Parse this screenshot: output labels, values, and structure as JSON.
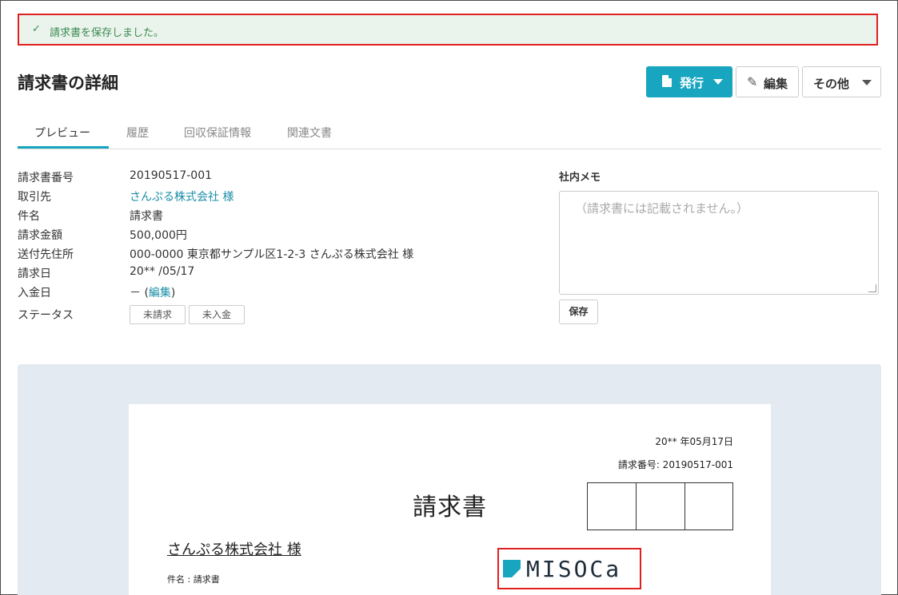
{
  "alert": {
    "message": "請求書を保存しました。",
    "status_color": "#3c8a52"
  },
  "header": {
    "title": "請求書の詳細",
    "issue_label": "発行",
    "edit_label": "編集",
    "more_label": "その他",
    "accent": "#18a5c0"
  },
  "tabs": [
    {
      "label": "プレビュー",
      "active": true
    },
    {
      "label": "履歴",
      "active": false
    },
    {
      "label": "回収保証情報",
      "active": false
    },
    {
      "label": "関連文書",
      "active": false
    }
  ],
  "details": {
    "invoice_no": {
      "label": "請求書番号",
      "value": "20190517-001"
    },
    "client": {
      "label": "取引先",
      "value": "さんぷる株式会社 様"
    },
    "subject": {
      "label": "件名",
      "value": "請求書"
    },
    "amount": {
      "label": "請求金額",
      "value": "500,000円"
    },
    "address": {
      "label": "送付先住所",
      "value": "000-0000 東京都サンプル区1-2-3 さんぷる株式会社 様"
    },
    "invoice_date": {
      "label": "請求日",
      "value": "20** /05/17"
    },
    "payment_date": {
      "label": "入金日",
      "value_prefix": "－ (",
      "edit_link": "編集",
      "value_suffix": ")"
    },
    "status": {
      "label": "ステータス",
      "tags": [
        "未請求",
        "未入金"
      ]
    }
  },
  "memo": {
    "label": "社内メモ",
    "placeholder": "（請求書には記載されません。）",
    "save_label": "保存"
  },
  "preview": {
    "date": "20** 年05月17日",
    "invoice_no": "請求番号: 20190517-001",
    "title": "請求書",
    "client": "さんぷる株式会社 様",
    "subject": "件名 : 請求書",
    "logo_text": "MISOCa"
  }
}
